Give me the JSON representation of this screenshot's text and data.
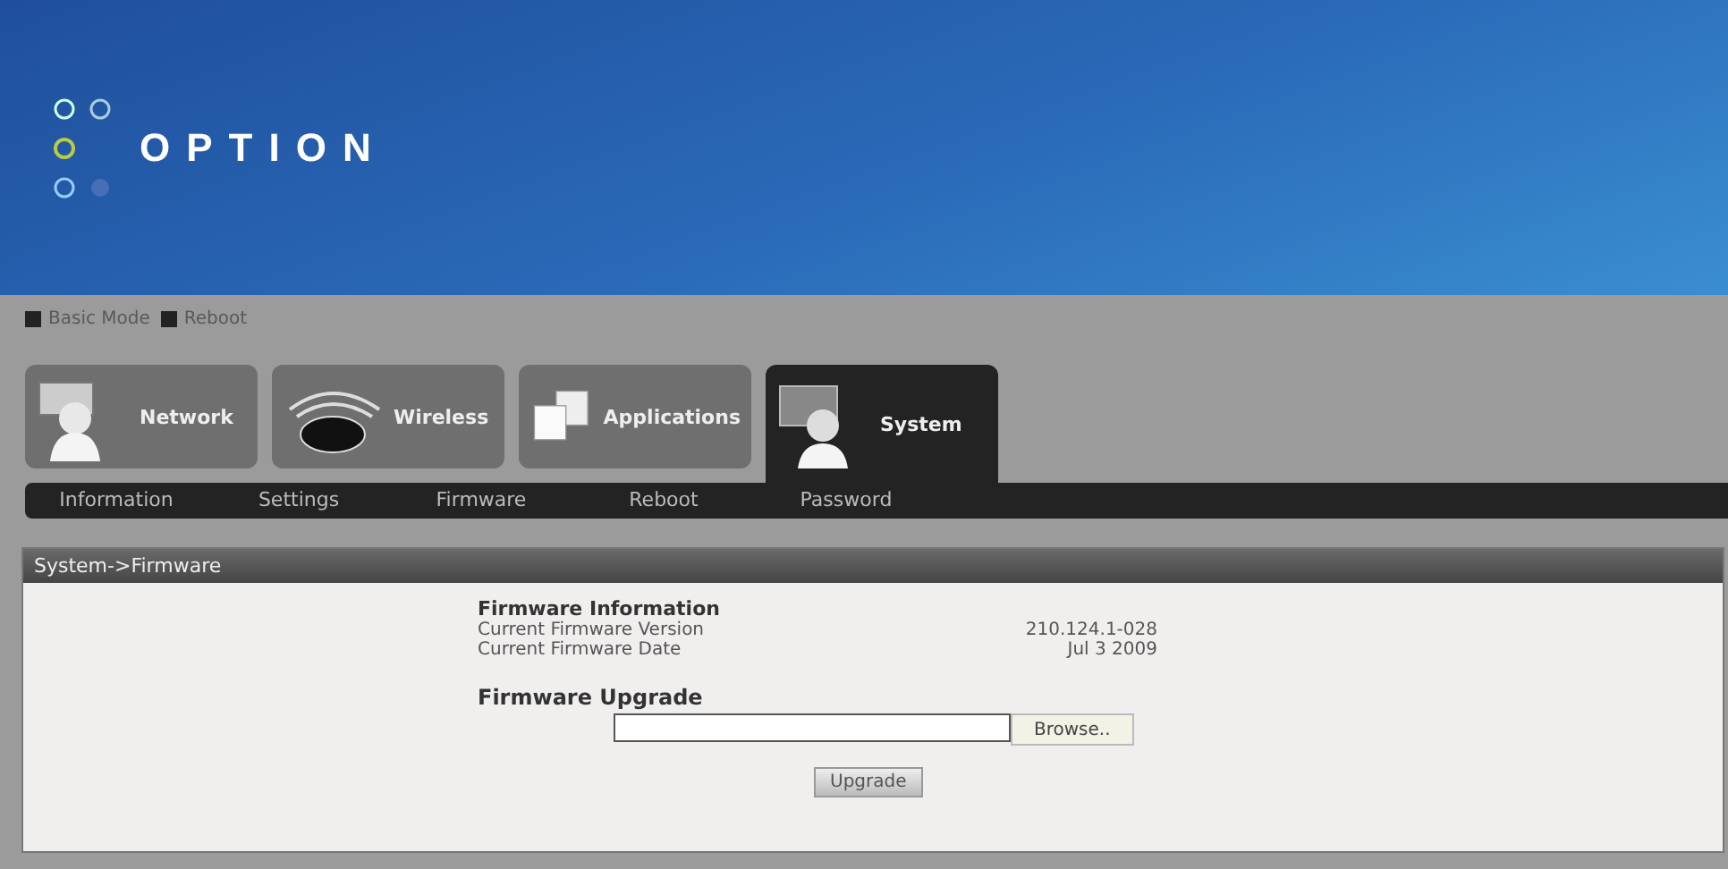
{
  "logo": {
    "text": "OPTION"
  },
  "top_links": [
    "Basic Mode",
    "Reboot"
  ],
  "tabs": [
    {
      "label": "Network",
      "kind": "network",
      "selected": false
    },
    {
      "label": "Wireless",
      "kind": "wireless",
      "selected": false
    },
    {
      "label": "Applications",
      "kind": "applications",
      "selected": false
    },
    {
      "label": "System",
      "kind": "system",
      "selected": true
    }
  ],
  "subnav": [
    "Information",
    "Settings",
    "Firmware",
    "Reboot",
    "Password"
  ],
  "panel": {
    "title": "System->Firmware",
    "info_heading": "Firmware Information",
    "info_rows": [
      {
        "label": "Current Firmware Version",
        "value": "210.124.1-028"
      },
      {
        "label": "Current Firmware Date",
        "value": "Jul 3 2009"
      }
    ],
    "upgrade_heading": "Firmware Upgrade",
    "browse_button": "Browse..",
    "upgrade_button": "Upgrade"
  }
}
